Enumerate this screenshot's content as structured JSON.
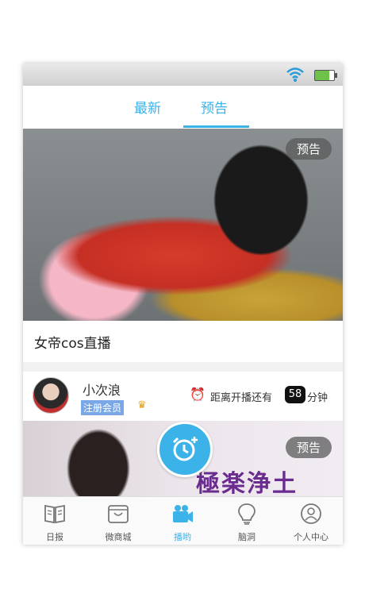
{
  "top_tabs": [
    {
      "label": "最新"
    },
    {
      "label": "预告"
    }
  ],
  "cards": [
    {
      "badge": "预告",
      "title": "女帝cos直播"
    },
    {
      "badge": "预告",
      "user": {
        "name": "小次浪",
        "member_label": "注册会员"
      },
      "countdown": {
        "prefix": "距离开播还有",
        "minutes": "58",
        "unit": "分钟"
      },
      "overlay_text": "極楽浄土"
    }
  ],
  "bottom_tabs": [
    {
      "label": "日报",
      "icon": "book-icon"
    },
    {
      "label": "微商城",
      "icon": "shop-icon"
    },
    {
      "label": "播哟",
      "icon": "video-camera-icon",
      "active": true
    },
    {
      "label": "脑洞",
      "icon": "lightbulb-icon"
    },
    {
      "label": "个人中心",
      "icon": "person-icon"
    }
  ],
  "colors": {
    "accent": "#3bb2e8",
    "member_badge": "#7aa7e6",
    "overlay_text": "#6a2c8f"
  }
}
